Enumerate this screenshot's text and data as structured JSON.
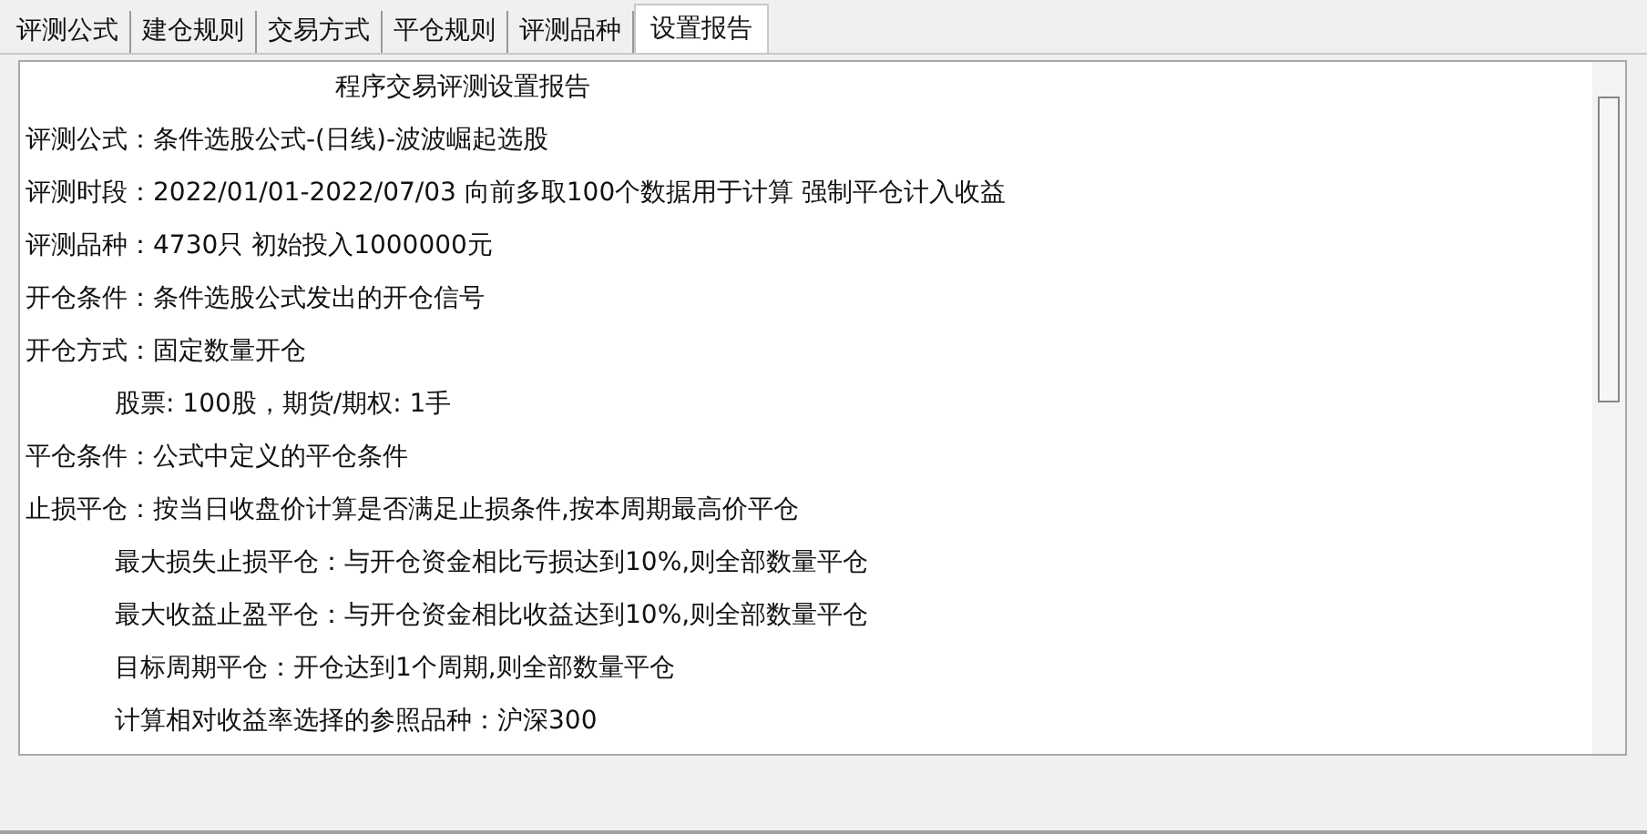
{
  "tabs": [
    {
      "label": "评测公式",
      "selected": false
    },
    {
      "label": "建仓规则",
      "selected": false
    },
    {
      "label": "交易方式",
      "selected": false
    },
    {
      "label": "平仓规则",
      "selected": false
    },
    {
      "label": "评测品种",
      "selected": false
    },
    {
      "label": "设置报告",
      "selected": true
    }
  ],
  "report": {
    "title": "程序交易评测设置报告",
    "lines": [
      {
        "text": "评测公式：条件选股公式-(日线)-波波崛起选股"
      },
      {
        "text": "评测时段：2022/01/01-2022/07/03 向前多取100个数据用于计算 强制平仓计入收益"
      },
      {
        "text": "评测品种：4730只 初始投入1000000元"
      },
      {
        "text": "开仓条件：条件选股公式发出的开仓信号"
      },
      {
        "text": "开仓方式：固定数量开仓",
        "children": [
          {
            "text": "股票: 100股，期货/期权: 1手"
          }
        ]
      },
      {
        "text": "平仓条件：公式中定义的平仓条件"
      },
      {
        "text": "止损平仓：按当日收盘价计算是否满足止损条件,按本周期最高价平仓",
        "children": [
          {
            "text": "最大损失止损平仓：与开仓资金相比亏损达到10%,则全部数量平仓"
          },
          {
            "text": "最大收益止盈平仓：与开仓资金相比收益达到10%,则全部数量平仓"
          },
          {
            "text": "目标周期平仓：开仓达到1个周期,则全部数量平仓"
          },
          {
            "text": "计算相对收益率选择的参照品种：沪深300"
          }
        ]
      }
    ]
  }
}
